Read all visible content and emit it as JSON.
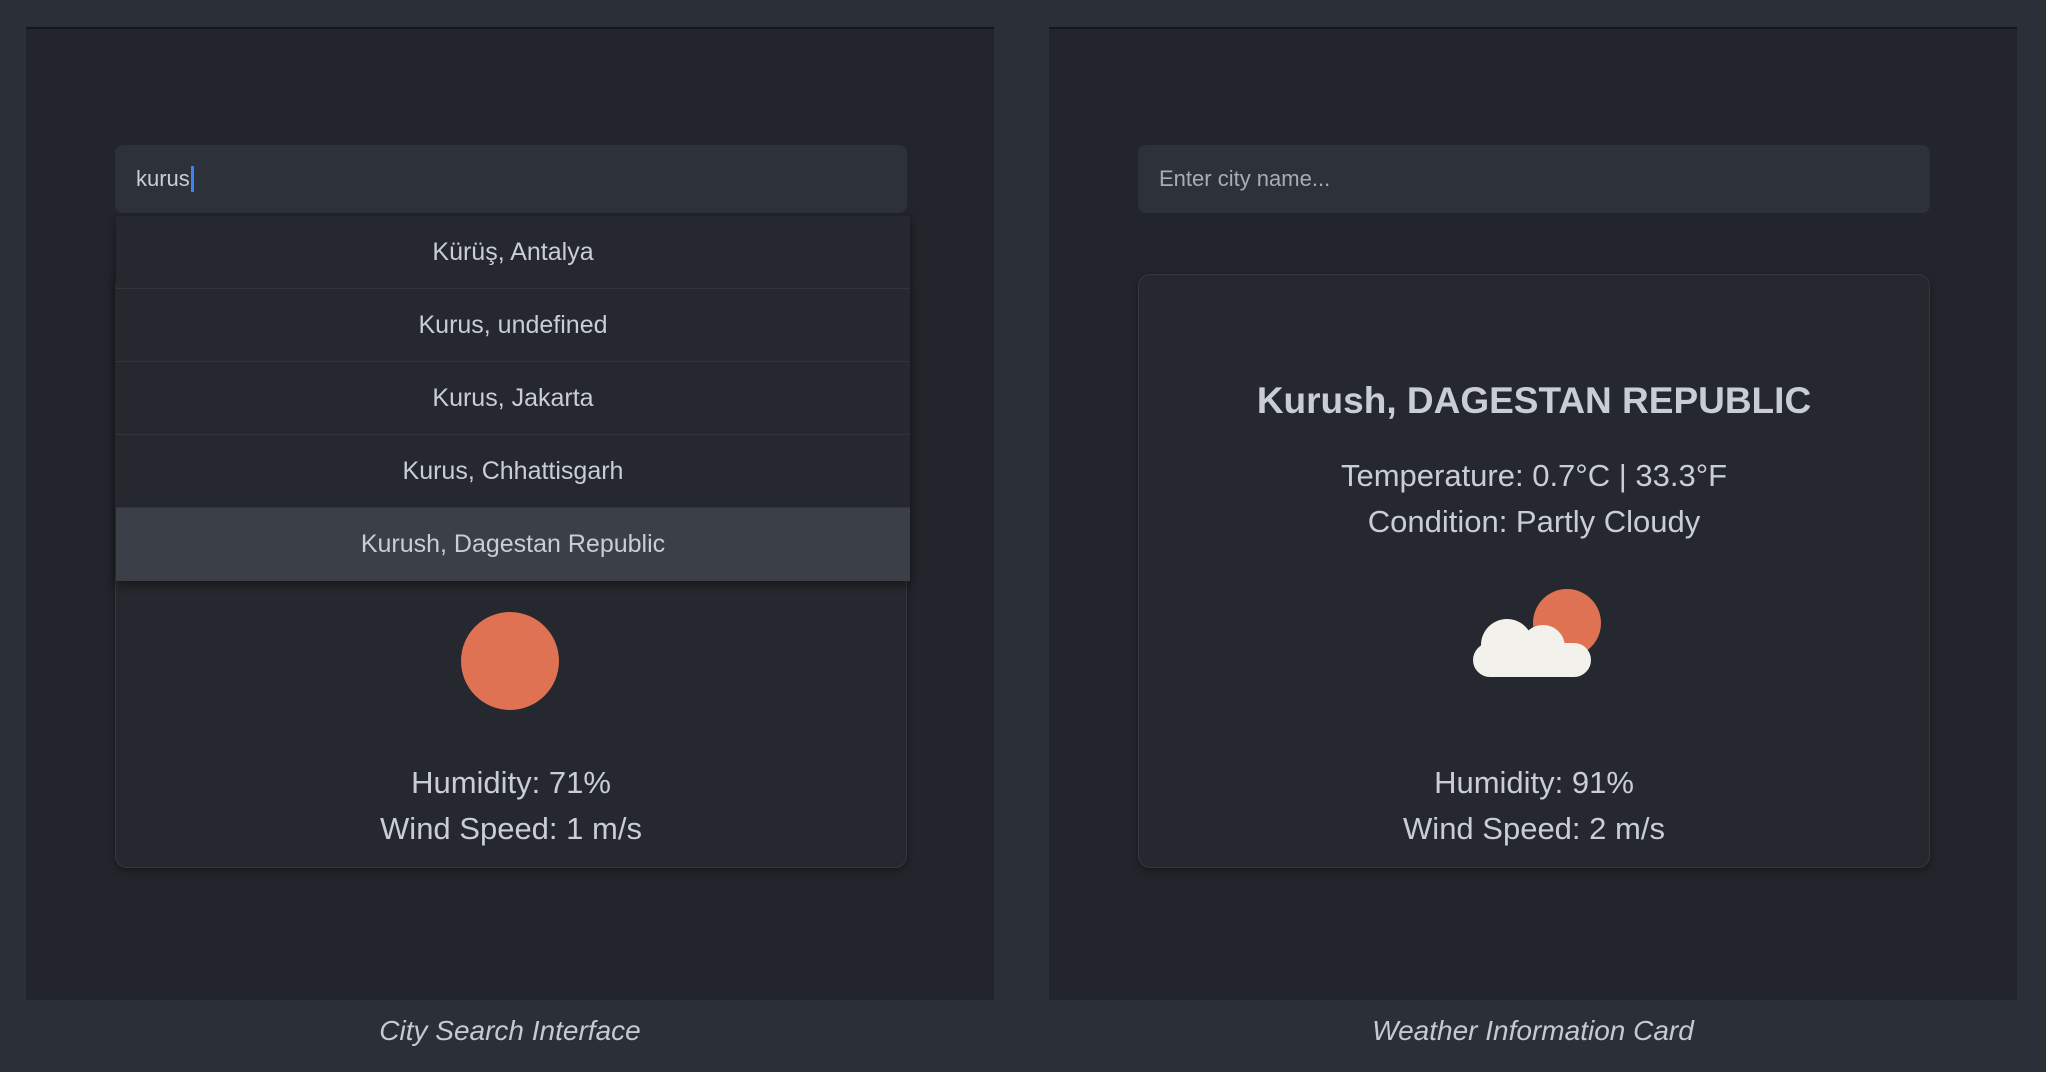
{
  "left_panel": {
    "search_value": "kurus",
    "suggestions": [
      "Kürüş, Antalya",
      "Kurus, undefined",
      "Kurus, Jakarta",
      "Kurus, Chhattisgarh",
      "Kurush, Dagestan Republic"
    ],
    "highlighted_index": 4,
    "weather_icon": "sun-icon",
    "humidity_text": "Humidity: 71%",
    "wind_text": "Wind Speed: 1 m/s",
    "caption": "City Search Interface"
  },
  "right_panel": {
    "search_placeholder": "Enter city name...",
    "city_title": "Kurush, DAGESTAN REPUBLIC",
    "temperature_text": "Temperature: 0.7°C | 33.3°F",
    "condition_text": "Condition: Partly Cloudy",
    "weather_icon": "partly-cloudy-icon",
    "humidity_text": "Humidity: 91%",
    "wind_text": "Wind Speed: 2 m/s",
    "caption": "Weather Information Card"
  },
  "colors": {
    "background": "#2b2f37",
    "panel": "#22252b",
    "card": "#25282e",
    "sun": "#e07254",
    "cloud": "#f2f1ec",
    "caret": "#3b82f6"
  }
}
